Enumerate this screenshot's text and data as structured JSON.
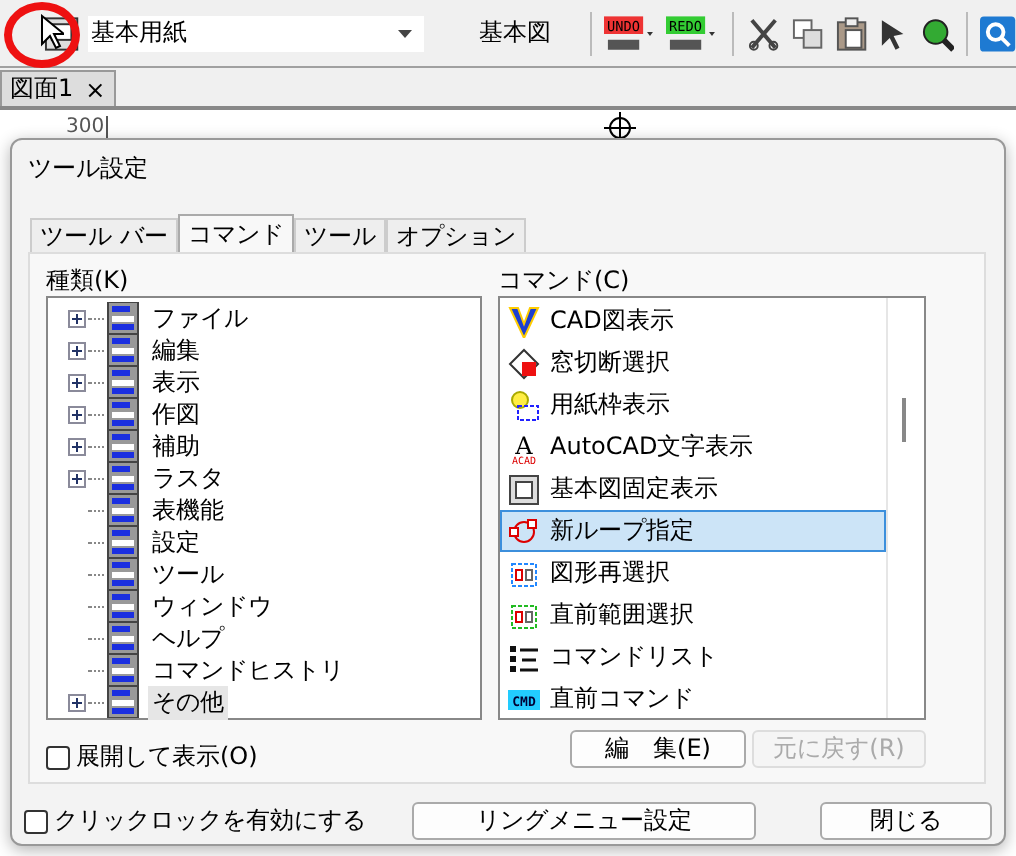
{
  "toolbar": {
    "paper_combo": {
      "value": "基本用紙"
    },
    "view_label": "基本図",
    "undo_label": "UNDO",
    "redo_label": "REDO"
  },
  "document_tab": {
    "label": "図面1",
    "close": "×"
  },
  "ruler": {
    "label": "300"
  },
  "dialog": {
    "title": "ツール設定",
    "tabs": [
      {
        "label": "ツール バー",
        "selected": false
      },
      {
        "label": "コマンド",
        "selected": true
      },
      {
        "label": "ツール",
        "selected": false
      },
      {
        "label": "オプション",
        "selected": false
      }
    ],
    "category_label": "種類(K)",
    "tree": [
      {
        "label": "ファイル",
        "expandable": true,
        "selected": false
      },
      {
        "label": "編集",
        "expandable": true,
        "selected": false
      },
      {
        "label": "表示",
        "expandable": true,
        "selected": false
      },
      {
        "label": "作図",
        "expandable": true,
        "selected": false
      },
      {
        "label": "補助",
        "expandable": true,
        "selected": false
      },
      {
        "label": "ラスタ",
        "expandable": true,
        "selected": false
      },
      {
        "label": "表機能",
        "expandable": false,
        "selected": false
      },
      {
        "label": "設定",
        "expandable": false,
        "selected": false
      },
      {
        "label": "ツール",
        "expandable": false,
        "selected": false
      },
      {
        "label": "ウィンドウ",
        "expandable": false,
        "selected": false
      },
      {
        "label": "ヘルプ",
        "expandable": false,
        "selected": false
      },
      {
        "label": "コマンドヒストリ",
        "expandable": false,
        "selected": false
      },
      {
        "label": "その他",
        "expandable": true,
        "selected": true
      }
    ],
    "command_label": "コマンド(C)",
    "commands": [
      {
        "label": "CAD図表示",
        "selected": false
      },
      {
        "label": "窓切断選択",
        "selected": false
      },
      {
        "label": "用紙枠表示",
        "selected": false
      },
      {
        "label": "AutoCAD文字表示",
        "selected": false,
        "glyph": "A",
        "badge": "ACAD"
      },
      {
        "label": "基本図固定表示",
        "selected": false
      },
      {
        "label": "新ループ指定",
        "selected": true
      },
      {
        "label": "図形再選択",
        "selected": false
      },
      {
        "label": "直前範囲選択",
        "selected": false
      },
      {
        "label": "コマンドリスト",
        "selected": false
      },
      {
        "label": "直前コマンド",
        "selected": false,
        "badge": "CMD"
      }
    ],
    "expand_checkbox": {
      "label": "展開して表示(O)",
      "checked": false
    },
    "edit_button": {
      "label": "編　集(E)",
      "disabled": false
    },
    "restore_button": {
      "label": "元に戻す(R)",
      "disabled": true
    },
    "clicklock_checkbox": {
      "label": "クリックロックを有効にする",
      "checked": false
    },
    "ring_menu_button": {
      "label": "リングメニュー設定",
      "disabled": false
    },
    "close_button": {
      "label": "閉じる",
      "disabled": false
    }
  }
}
